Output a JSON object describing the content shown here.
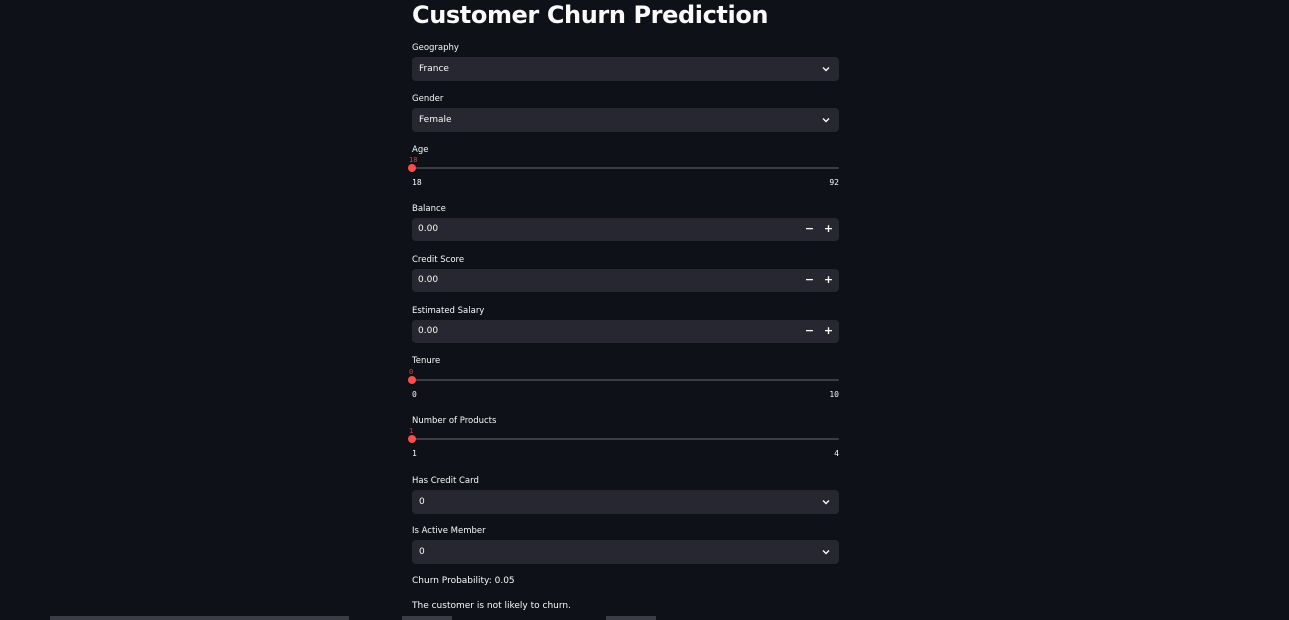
{
  "page": {
    "title": "Customer Churn Prediction"
  },
  "fields": {
    "geography": {
      "label": "Geography",
      "value": "France"
    },
    "gender": {
      "label": "Gender",
      "value": "Female"
    },
    "age": {
      "label": "Age",
      "value": "18",
      "min": "18",
      "max": "92",
      "fraction": 0
    },
    "balance": {
      "label": "Balance",
      "value": "0.00"
    },
    "credit_score": {
      "label": "Credit Score",
      "value": "0.00"
    },
    "estimated_salary": {
      "label": "Estimated Salary",
      "value": "0.00"
    },
    "tenure": {
      "label": "Tenure",
      "value": "0",
      "min": "0",
      "max": "10",
      "fraction": 0
    },
    "num_products": {
      "label": "Number of Products",
      "value": "1",
      "min": "1",
      "max": "4",
      "fraction": 0
    },
    "has_credit_card": {
      "label": "Has Credit Card",
      "value": "0"
    },
    "is_active_member": {
      "label": "Is Active Member",
      "value": "0"
    }
  },
  "stepper": {
    "minus": "−",
    "plus": "+"
  },
  "result": {
    "probability": "Churn Probability: 0.05",
    "message": "The customer is not likely to churn."
  },
  "colors": {
    "background": "#0e1117",
    "input_bg": "#262730",
    "accent": "#ff4b4b",
    "text": "#fafafa"
  },
  "icons": {
    "dropdown": "chevron-down-icon"
  }
}
